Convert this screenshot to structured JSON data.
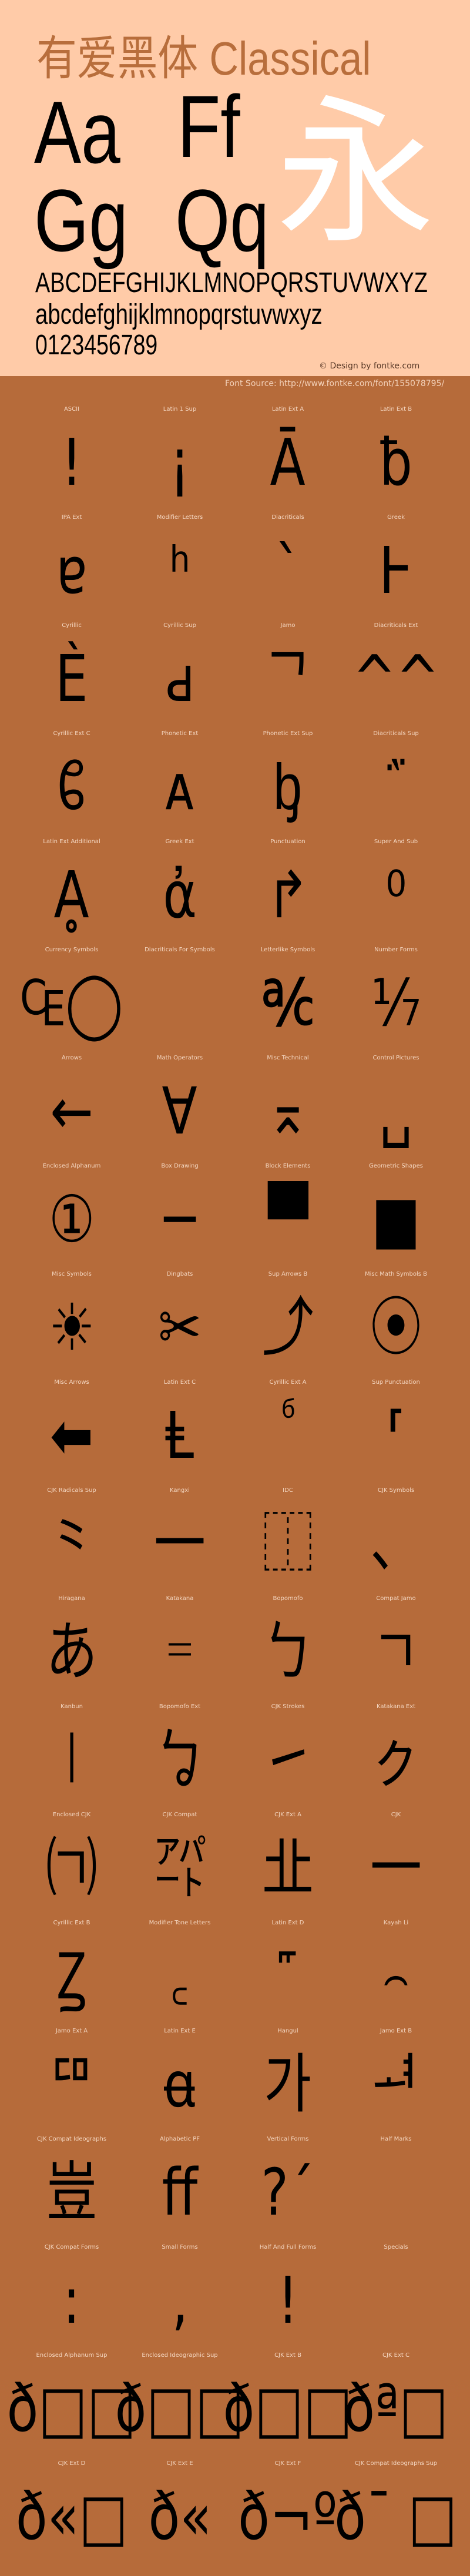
{
  "header": {
    "title": "有爱黑体 Classical",
    "sample_pairs": [
      "Aa",
      "Ff",
      "Gg",
      "Qq"
    ],
    "feature_char": "永",
    "uppercase": "ABCDEFGHIJKLMNOPQRSTUVWXYZ",
    "lowercase": "abcdefghijklmnopqrstuvwxyz",
    "digits": "0123456789",
    "credit": "© Design by fontke.com",
    "source": "Font Source: http://www.fontke.com/font/155078795/"
  },
  "colors": {
    "header_bg": "#FFCBA8",
    "body_bg": "#B66B3A",
    "title": "#B86E3C",
    "feature_char": "#FFFFFF",
    "glyph": "#000000"
  },
  "cells": [
    {
      "label": "ASCII",
      "glyph": "!"
    },
    {
      "label": "Latin 1 Sup",
      "glyph": "¡"
    },
    {
      "label": "Latin Ext A",
      "glyph": "Ā"
    },
    {
      "label": "Latin Ext B",
      "glyph": "ƀ"
    },
    {
      "label": "IPA Ext",
      "glyph": "ɐ"
    },
    {
      "label": "Modifier Letters",
      "glyph": "ʰ"
    },
    {
      "label": "Diacriticals",
      "glyph": "`"
    },
    {
      "label": "Greek",
      "glyph": "Ͱ"
    },
    {
      "label": "Cyrillic",
      "glyph": "Ѐ"
    },
    {
      "label": "Cyrillic Sup",
      "glyph": "ԁ"
    },
    {
      "label": "Jamo",
      "glyph": "ᄀ"
    },
    {
      "label": "Diacriticals Ext",
      "glyph": "^^"
    },
    {
      "label": "Cyrillic Ext C",
      "glyph": "ᲀ"
    },
    {
      "label": "Phonetic Ext",
      "glyph": "ᴀ"
    },
    {
      "label": "Phonetic Ext Sup",
      "glyph": "ᶀ"
    },
    {
      "label": "Diacriticals Sup",
      "glyph": "᷀"
    },
    {
      "label": "Latin Ext Additional",
      "glyph": "Ḁ"
    },
    {
      "label": "Greek Ext",
      "glyph": "ἀ"
    },
    {
      "label": "Punctuation",
      "glyph": "↱"
    },
    {
      "label": "Super And Sub",
      "glyph": "⁰"
    },
    {
      "label": "Currency Symbols",
      "glyph": "₠◯"
    },
    {
      "label": "Diacriticals For Symbols",
      "glyph": ""
    },
    {
      "label": "Letterlike Symbols",
      "glyph": "℀"
    },
    {
      "label": "Number Forms",
      "glyph": "⅐"
    },
    {
      "label": "Arrows",
      "glyph": "←"
    },
    {
      "label": "Math Operators",
      "glyph": "∀"
    },
    {
      "label": "Misc Technical",
      "glyph": "⌅"
    },
    {
      "label": "Control Pictures",
      "glyph": "␣"
    },
    {
      "label": "Enclosed Alphanum",
      "glyph": "①"
    },
    {
      "label": "Box Drawing",
      "glyph": "─"
    },
    {
      "label": "Block Elements",
      "glyph": "▀"
    },
    {
      "label": "Geometric Shapes",
      "glyph": "■"
    },
    {
      "label": "Misc Symbols",
      "glyph": "☀"
    },
    {
      "label": "Dingbats",
      "glyph": "✂"
    },
    {
      "label": "Sup Arrows B",
      "glyph": "⤴"
    },
    {
      "label": "Misc Math Symbols B",
      "glyph": "⦿"
    },
    {
      "label": "Misc Arrows",
      "glyph": "⬅"
    },
    {
      "label": "Latin Ext C",
      "glyph": "Ⱡ"
    },
    {
      "label": "Cyrillic Ext A",
      "glyph": "ⷠ"
    },
    {
      "label": "Sup Punctuation",
      "glyph": "⸢"
    },
    {
      "label": "CJK Radicals Sup",
      "glyph": "⺀"
    },
    {
      "label": "Kangxi",
      "glyph": "⼀"
    },
    {
      "label": "IDC",
      "glyph": "⿰"
    },
    {
      "label": "CJK Symbols",
      "glyph": "、"
    },
    {
      "label": "Hiragana",
      "glyph": "あ"
    },
    {
      "label": "Katakana",
      "glyph": "゠"
    },
    {
      "label": "Bopomofo",
      "glyph": "ㄅ"
    },
    {
      "label": "Compat Jamo",
      "glyph": "ㄱ"
    },
    {
      "label": "Kanbun",
      "glyph": "㆐"
    },
    {
      "label": "Bopomofo Ext",
      "glyph": "ㆠ"
    },
    {
      "label": "CJK Strokes",
      "glyph": "㇀"
    },
    {
      "label": "Katakana Ext",
      "glyph": "ㇰ"
    },
    {
      "label": "Enclosed CJK",
      "glyph": "㈀"
    },
    {
      "label": "CJK Compat",
      "glyph": "㌀"
    },
    {
      "label": "CJK Ext A",
      "glyph": "㐀"
    },
    {
      "label": "CJK",
      "glyph": "一"
    },
    {
      "label": "Cyrillic Ext B",
      "glyph": "Ꙁ"
    },
    {
      "label": "Modifier Tone Letters",
      "glyph": "꜀"
    },
    {
      "label": "Latin Ext D",
      "glyph": "꜠"
    },
    {
      "label": "Kayah Li",
      "glyph": "꤮"
    },
    {
      "label": "Jamo Ext A",
      "glyph": "ꥠ"
    },
    {
      "label": "Latin Ext E",
      "glyph": "ꬰ"
    },
    {
      "label": "Hangul",
      "glyph": "가"
    },
    {
      "label": "Jamo Ext B",
      "glyph": "ힰ"
    },
    {
      "label": "CJK Compat Ideographs",
      "glyph": "豈"
    },
    {
      "label": "Alphabetic PF",
      "glyph": "ﬀ"
    },
    {
      "label": "Vertical Forms",
      "glyph": "?´"
    },
    {
      "label": "Half Marks",
      "glyph": ""
    },
    {
      "label": "CJK Compat Forms",
      "glyph": ":"
    },
    {
      "label": "Small Forms",
      "glyph": ","
    },
    {
      "label": "Half And Full Forms",
      "glyph": "!"
    },
    {
      "label": "Specials",
      "glyph": "￼"
    },
    {
      "label": "Enclosed Alphanum Sup",
      "glyph": "ð□□"
    },
    {
      "label": "Enclosed Ideographic Sup",
      "glyph": "ð□□"
    },
    {
      "label": "CJK Ext B",
      "glyph": "ð□□"
    },
    {
      "label": "CJK Ext C",
      "glyph": "ðª□"
    },
    {
      "label": "CJK Ext D",
      "glyph": "ð«□"
    },
    {
      "label": "CJK Ext E",
      "glyph": "ð«"
    },
    {
      "label": "CJK Ext F",
      "glyph": "ð¬º"
    },
    {
      "label": "CJK Compat Ideographs Sup",
      "glyph": "ð¯ □"
    }
  ]
}
